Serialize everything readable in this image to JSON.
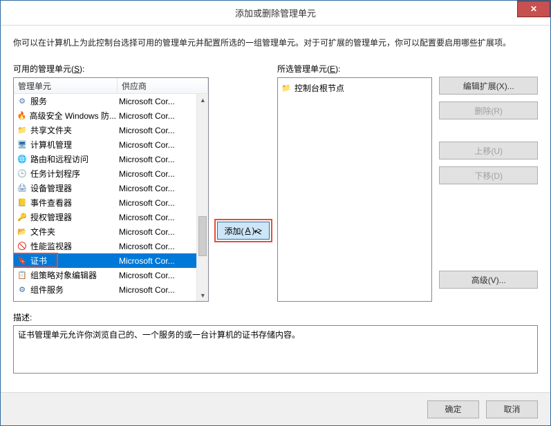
{
  "window": {
    "title": "添加或删除管理单元",
    "description": "你可以在计算机上为此控制台选择可用的管理单元并配置所选的一组管理单元。对于可扩展的管理单元，你可以配置要启用哪些扩展项。",
    "close_glyph": "✕"
  },
  "available": {
    "label_prefix": "可用的管理单元(",
    "label_ul": "S",
    "label_suffix": "):",
    "col_snapin": "管理单元",
    "col_vendor": "供应商",
    "vendor": "Microsoft Cor...",
    "items": [
      {
        "icon": "⚙",
        "cls": "ic-gear",
        "name": "服务"
      },
      {
        "icon": "🔥",
        "cls": "ic-fire",
        "name": "高级安全 Windows 防..."
      },
      {
        "icon": "📁",
        "cls": "ic-folder",
        "name": "共享文件夹"
      },
      {
        "icon": "🖥",
        "cls": "ic-monitor",
        "name": "计算机管理"
      },
      {
        "icon": "🌐",
        "cls": "ic-globe",
        "name": "路由和远程访问"
      },
      {
        "icon": "🕒",
        "cls": "ic-clock",
        "name": "任务计划程序"
      },
      {
        "icon": "🖨",
        "cls": "ic-printer",
        "name": "设备管理器"
      },
      {
        "icon": "📒",
        "cls": "ic-event",
        "name": "事件查看器"
      },
      {
        "icon": "🔑",
        "cls": "ic-key",
        "name": "授权管理器"
      },
      {
        "icon": "📂",
        "cls": "ic-folder",
        "name": "文件夹"
      },
      {
        "icon": "🚫",
        "cls": "ic-block",
        "name": "性能监视器"
      },
      {
        "icon": "🔖",
        "cls": "ic-cert",
        "name": "证书"
      },
      {
        "icon": "📋",
        "cls": "ic-group",
        "name": "组策略对象编辑器"
      },
      {
        "icon": "⚙",
        "cls": "ic-svc",
        "name": "组件服务"
      }
    ],
    "selected_index": 11
  },
  "middle": {
    "add_label_prefix": "添加(",
    "add_label_ul": "A",
    "add_label_suffix": ")  >",
    "cursor": "↖"
  },
  "selected": {
    "label_prefix": "所选管理单元(",
    "label_ul": "E",
    "label_suffix": "):",
    "root_icon": "📁",
    "root_label": "控制台根节点"
  },
  "right_buttons": {
    "edit_ext": "编辑扩展(X)...",
    "remove": "删除(R)",
    "move_up": "上移(U)",
    "move_down": "下移(D)",
    "advanced": "高级(V)..."
  },
  "description_section": {
    "label": "描述:",
    "text": "证书管理单元允许你浏览自己的、一个服务的或一台计算机的证书存储内容。"
  },
  "footer": {
    "ok": "确定",
    "cancel": "取消"
  },
  "scrollbar": {
    "up": "▲",
    "down": "▼"
  }
}
